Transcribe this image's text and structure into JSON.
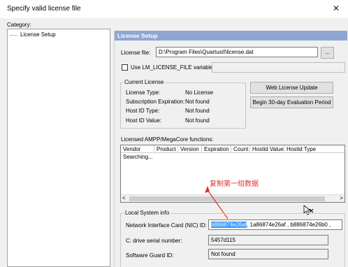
{
  "window": {
    "title": "Specify valid license file",
    "close_glyph": "✕"
  },
  "category": {
    "label": "Category:",
    "items": [
      "License Setup"
    ]
  },
  "panel": {
    "header": "License Setup",
    "license_file_label": "License file:",
    "license_file_value": "D:\\Program Files\\QuartusII\\license.dat",
    "browse_button": "...",
    "use_lm_label": "Use LM_LICENSE_FILE variable:",
    "use_lm_value": ""
  },
  "current_license": {
    "legend": "Current License",
    "rows": [
      {
        "label": "License Type:",
        "value": "No License"
      },
      {
        "label": "Subscription Expiration:",
        "value": "Not found"
      },
      {
        "label": "Host ID Type:",
        "value": "Not found"
      },
      {
        "label": "Host ID Value:",
        "value": "Not found"
      }
    ]
  },
  "buttons": {
    "web_update": "Web License Update",
    "eval": "Begin 30-day Evaluation Period"
  },
  "functions": {
    "label": "Licensed AMPP/MegaCore functions:",
    "columns": [
      "Vendor",
      "Product",
      "Version",
      "Expiration",
      "Count",
      "Hostid Value",
      "Hostid Type"
    ],
    "status_text": "Searching..."
  },
  "annotation": {
    "text": "复制第一组数据"
  },
  "local_system": {
    "legend": "Local System info",
    "nic_label": "Network Interface Card (NIC) ID:",
    "nic_selected": "b886874e26af",
    "nic_rest": ", 1a86874e26af , b886874e26b0 ,",
    "drive_label": "C: drive serial number:",
    "drive_value": "5457d115",
    "guard_label": "Software Guard ID:",
    "guard_value": "Not found"
  },
  "colors": {
    "header_bg": "#8fa7cf",
    "annotation": "#e0322f",
    "selection": "#3399ff"
  }
}
